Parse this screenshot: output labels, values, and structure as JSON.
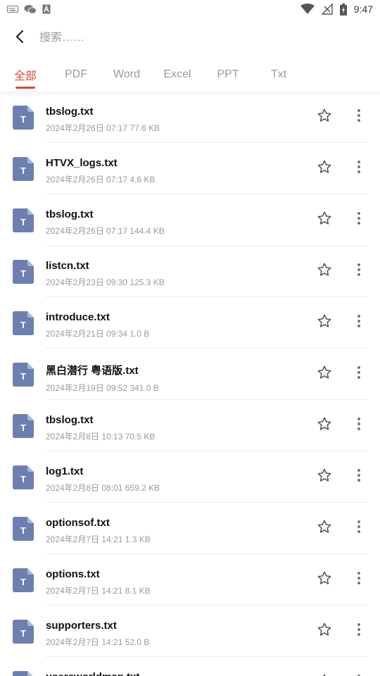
{
  "status_bar": {
    "time": "9:47",
    "left_icons": [
      "keyboard-icon",
      "wechat-icon",
      "a-box-icon"
    ],
    "right_icons": [
      "wifi-icon",
      "no-signal-icon",
      "battery-charging-icon"
    ]
  },
  "header": {
    "back_icon": "back-arrow-icon",
    "search_placeholder": "搜索……",
    "search_value": ""
  },
  "tabs": [
    {
      "label": "全部",
      "active": true
    },
    {
      "label": "PDF",
      "active": false
    },
    {
      "label": "Word",
      "active": false
    },
    {
      "label": "Excel",
      "active": false
    },
    {
      "label": "PPT",
      "active": false
    },
    {
      "label": "Txt",
      "active": false
    }
  ],
  "colors": {
    "accent": "#e0492d",
    "file_icon": "#6c7fb0",
    "muted_text": "#9a9a9a"
  },
  "files": [
    {
      "name": "tbslog.txt",
      "meta": "2024年2月26日 07:17 77.6 KB",
      "icon_letter": "T"
    },
    {
      "name": "HTVX_logs.txt",
      "meta": "2024年2月26日 07:17 4.6 KB",
      "icon_letter": "T"
    },
    {
      "name": "tbslog.txt",
      "meta": "2024年2月26日 07:17 144.4 KB",
      "icon_letter": "T"
    },
    {
      "name": "listcn.txt",
      "meta": "2024年2月23日 09:30 125.3 KB",
      "icon_letter": "T"
    },
    {
      "name": "introduce.txt",
      "meta": "2024年2月21日 09:34 1.0 B",
      "icon_letter": "T"
    },
    {
      "name": "黑白潜行 粤语版.txt",
      "meta": "2024年2月19日 09:52 341.0 B",
      "icon_letter": "T"
    },
    {
      "name": "tbslog.txt",
      "meta": "2024年2月8日 10:13 70.5 KB",
      "icon_letter": "T"
    },
    {
      "name": "log1.txt",
      "meta": "2024年2月8日 08:01 659.2 KB",
      "icon_letter": "T"
    },
    {
      "name": "optionsof.txt",
      "meta": "2024年2月7日 14:21 1.3 KB",
      "icon_letter": "T"
    },
    {
      "name": "options.txt",
      "meta": "2024年2月7日 14:21 8.1 KB",
      "icon_letter": "T"
    },
    {
      "name": "supporters.txt",
      "meta": "2024年2月7日 14:21 52.0 B",
      "icon_letter": "T"
    },
    {
      "name": "usercworldmap.txt",
      "meta": "",
      "icon_letter": "T"
    }
  ]
}
